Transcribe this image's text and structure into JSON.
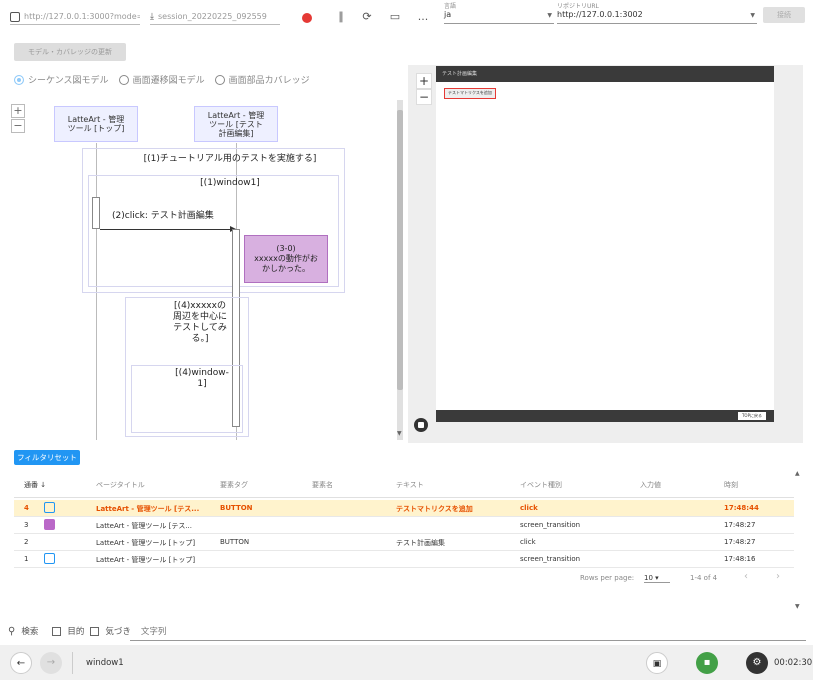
{
  "toolbar": {
    "url": "http://127.0.0.1:3000?mode=ma",
    "session": "session_20220225_092559",
    "language_label": "言語",
    "language_value": "ja",
    "repo_label": "リポジトリURL",
    "repo_value": "http://127.0.0.1:3002",
    "connect_label": "接続",
    "more_label": "..."
  },
  "model_update_label": "モデル・カバレッジの更新",
  "radios": [
    {
      "label": "シーケンス図モデル",
      "selected": true
    },
    {
      "label": "画面遷移図モデル",
      "selected": false
    },
    {
      "label": "画面部品カバレッジ",
      "selected": false
    }
  ],
  "diagram": {
    "zoom_in": "+",
    "zoom_out": "−",
    "lifeline1": "LatteArt - 管理\nツール [トップ]",
    "lifeline2": "LatteArt - 管理\nツール [テスト\n計画編集]",
    "frame1_title": "[(1)チュートリアル用のテストを実施する]",
    "frame2_title": "[(1)window1]",
    "message": "(2)click: テスト計画編集",
    "note_title": "(3-0)",
    "note_text": "xxxxxの動作がお\nかしかった。",
    "frame3_title": "[(4)xxxxxの\n周辺を中心に\nテストしてみ\nる。]",
    "frame4_title": "[(4)window-\n1]"
  },
  "preview": {
    "title": "テスト計画編集",
    "highlight_label": "テストマトリクスを追加",
    "footer_button": "TOPに戻る",
    "zoom_in": "+",
    "zoom_out": "−"
  },
  "filter_reset_label": "フィルタリセット",
  "table": {
    "headers": [
      "通番 ↓",
      "ページタイトル",
      "要素タグ",
      "要素名",
      "テキスト",
      "イベント種別",
      "入力値",
      "時刻"
    ],
    "rows": [
      {
        "seq": "4",
        "icon": "calendar-icon",
        "icon_color": "#2196f3",
        "title": "LatteArt - 管理ツール [テス...",
        "tag": "BUTTON",
        "name": "",
        "text": "テストマトリクスを追加",
        "event": "click",
        "input": "",
        "time": "17:48:44",
        "selected": true
      },
      {
        "seq": "3",
        "icon": "comment-icon",
        "icon_color": "#ba68c8",
        "title": "LatteArt - 管理ツール [テス...",
        "tag": "",
        "name": "",
        "text": "",
        "event": "screen_transition",
        "input": "",
        "time": "17:48:27",
        "selected": false
      },
      {
        "seq": "2",
        "icon": "",
        "icon_color": "",
        "title": "LatteArt - 管理ツール [トップ]",
        "tag": "BUTTON",
        "name": "",
        "text": "テスト計画編集",
        "event": "click",
        "input": "",
        "time": "17:48:27",
        "selected": false
      },
      {
        "seq": "1",
        "icon": "calendar-icon",
        "icon_color": "#2196f3",
        "title": "LatteArt - 管理ツール [トップ]",
        "tag": "",
        "name": "",
        "text": "",
        "event": "screen_transition",
        "input": "",
        "time": "17:48:16",
        "selected": false
      }
    ],
    "rows_per_page_label": "Rows per page:",
    "rows_per_page": "10",
    "range": "1-4 of 4"
  },
  "search": {
    "label": "検索",
    "purpose_label": "目的",
    "notice_label": "気づき",
    "string_label": "文字列"
  },
  "bottom": {
    "window": "window1",
    "elapsed": "00:02:30",
    "accent_green": "#43a047"
  }
}
